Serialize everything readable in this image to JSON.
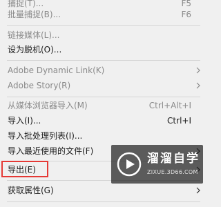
{
  "menu": {
    "items": [
      {
        "label": "捕捉(T)...",
        "shortcut": "F5",
        "disabled": true
      },
      {
        "label": "批量捕捉(B)...",
        "shortcut": "F6",
        "disabled": true
      },
      {
        "label": "链接媒体(L)...",
        "disabled": true
      },
      {
        "label": "设为脱机(O)...",
        "disabled": false
      },
      {
        "label": "Adobe Dynamic Link(K)",
        "disabled": true,
        "submenu": true
      },
      {
        "label": "Adobe Story(R)",
        "disabled": true,
        "submenu": true
      },
      {
        "label": "从媒体浏览器导入(M)",
        "shortcut": "Ctrl+Alt+I",
        "disabled": true
      },
      {
        "label": "导入(I)...",
        "shortcut": "Ctrl+I",
        "disabled": false
      },
      {
        "label": "导入批处理列表(I)...",
        "disabled": false
      },
      {
        "label": "导入最近使用的文件(F)",
        "disabled": false,
        "submenu": true
      },
      {
        "label": "导出(E)",
        "disabled": false,
        "submenu": true,
        "highlighted": true
      },
      {
        "label": "获取属性(G)",
        "disabled": false,
        "submenu": true
      }
    ],
    "highlight_color": "#e53935"
  },
  "watermark": {
    "title": "溜溜自学",
    "url": "ZIXUE.3D66.COM",
    "icon": "play-logo-icon"
  }
}
